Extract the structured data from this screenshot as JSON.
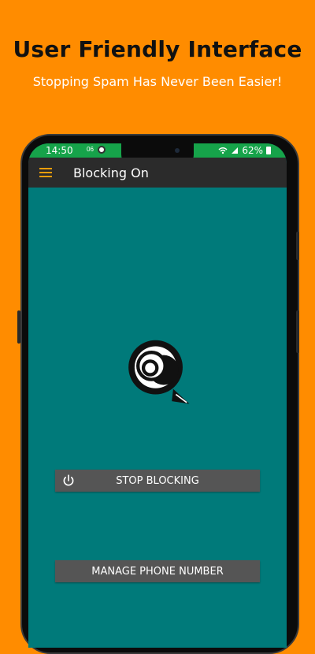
{
  "promo": {
    "title": "User Friendly Interface",
    "subtitle": "Stopping Spam Has Never Been Easier!"
  },
  "status_bar": {
    "time": "14:50",
    "battery": "62%",
    "extra": "06"
  },
  "app_bar": {
    "title": "Blocking On"
  },
  "buttons": {
    "stop_blocking": "STOP BLOCKING",
    "manage_phone": "MANAGE PHONE NUMBER"
  },
  "colors": {
    "background": "#FF8C00",
    "screen": "#007A7A",
    "status_bar": "#16A34A",
    "app_bar": "#2B2B2B",
    "menu_icon": "#F59E0B",
    "button": "#555555"
  },
  "icons": {
    "menu": "hamburger-menu-icon",
    "power": "power-icon",
    "logo": "call-blocker-logo-icon"
  }
}
